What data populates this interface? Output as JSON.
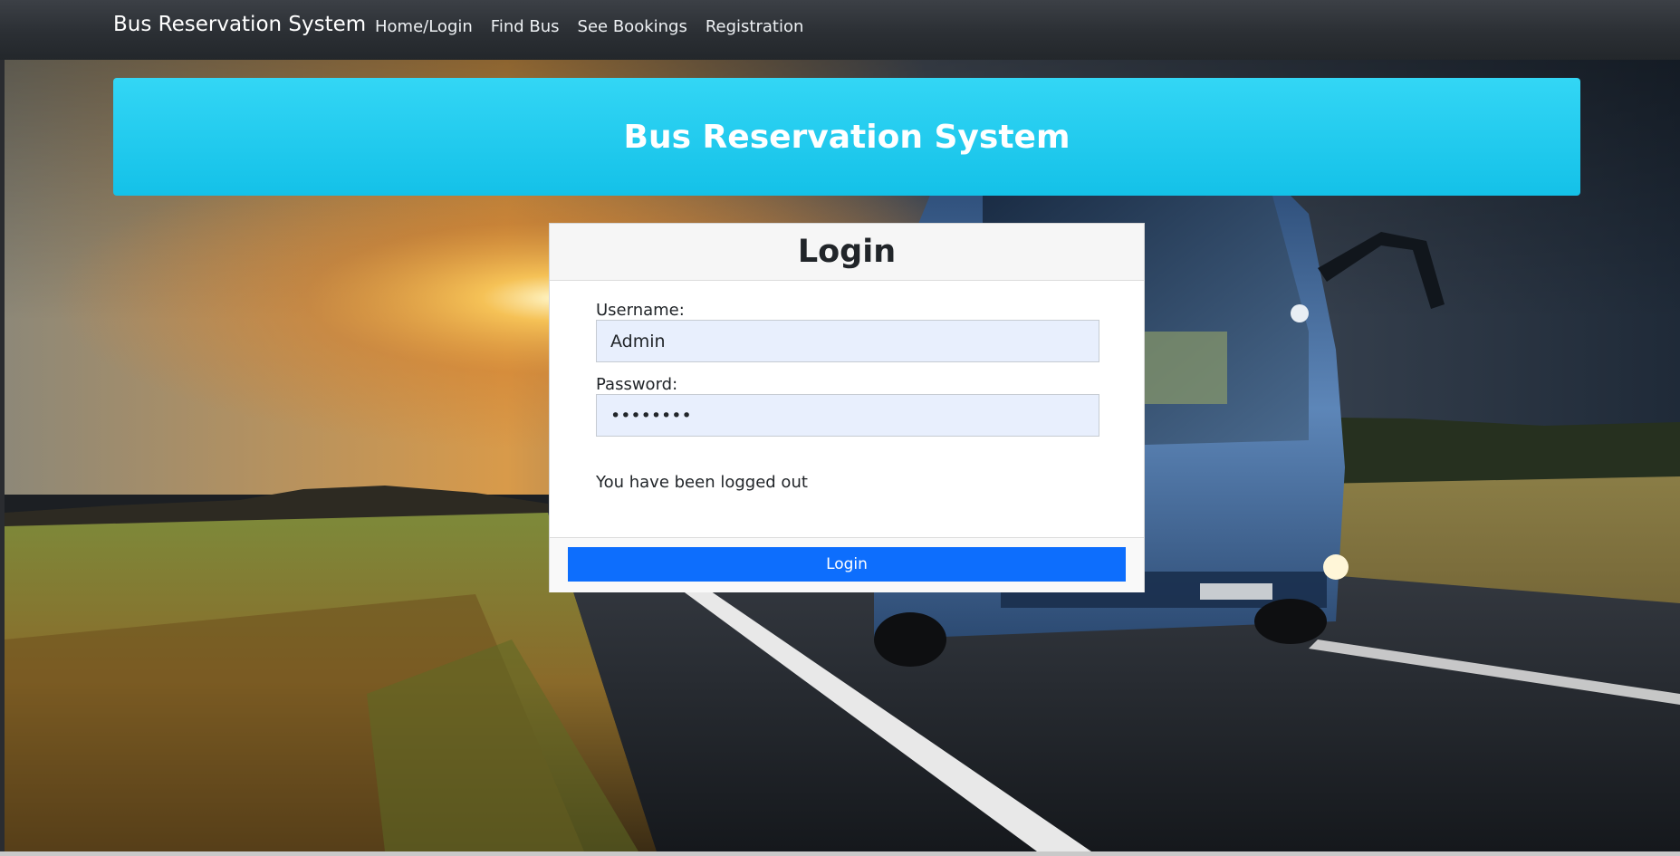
{
  "navbar": {
    "brand": "Bus Reservation System",
    "links": [
      {
        "label": "Home/Login"
      },
      {
        "label": "Find Bus"
      },
      {
        "label": "See Bookings"
      },
      {
        "label": "Registration"
      }
    ]
  },
  "banner": {
    "title": "Bus Reservation System"
  },
  "login_card": {
    "title": "Login",
    "username": {
      "label": "Username:",
      "value": "Admin"
    },
    "password": {
      "label": "Password:",
      "value": "••••••••"
    },
    "status_message": "You have been logged out",
    "submit_label": "Login"
  },
  "colors": {
    "navbar_bg": "#2b2f34",
    "banner_bg": "#1fc8ee",
    "input_bg": "#e8effd",
    "primary_button": "#0d6efd"
  }
}
